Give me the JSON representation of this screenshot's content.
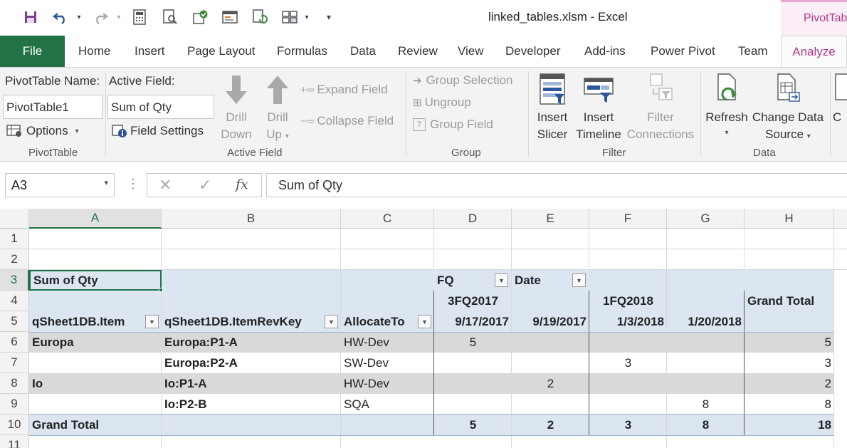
{
  "titlebar": {
    "title": "linked_tables.xlsm  -  Excel",
    "context_tab": "PivotTabl"
  },
  "tabs": [
    "Home",
    "Insert",
    "Page Layout",
    "Formulas",
    "Data",
    "Review",
    "View",
    "Developer",
    "Add-ins",
    "Power Pivot",
    "Team"
  ],
  "file_tab": "File",
  "active_tab": "Analyze",
  "ribbon": {
    "pivottable_name_label": "PivotTable Name:",
    "pivottable_name_value": "PivotTable1",
    "options_label": "Options",
    "pivottable_group": "PivotTable",
    "active_field_label": "Active Field:",
    "active_field_value": "Sum of Qty",
    "field_settings_label": "Field Settings",
    "drill_down": [
      "Drill",
      "Down"
    ],
    "drill_up": [
      "Drill",
      "Up"
    ],
    "expand_field": "Expand Field",
    "collapse_field": "Collapse Field",
    "active_field_group": "Active Field",
    "group_selection": "Group Selection",
    "ungroup": "Ungroup",
    "group_field": "Group Field",
    "group_group": "Group",
    "insert_slicer": [
      "Insert",
      "Slicer"
    ],
    "insert_timeline": [
      "Insert",
      "Timeline"
    ],
    "filter_connections": [
      "Filter",
      "Connections"
    ],
    "filter_group": "Filter",
    "refresh": "Refresh",
    "change_data_source": [
      "Change Data",
      "Source"
    ],
    "data_group": "Data",
    "cut_off": "C"
  },
  "formula_bar": {
    "name_box": "A3",
    "fx": "fx",
    "formula": "Sum of Qty"
  },
  "columns": [
    "A",
    "B",
    "C",
    "D",
    "E",
    "F",
    "G",
    "H"
  ],
  "rows": [
    "1",
    "2",
    "3",
    "4",
    "5",
    "6",
    "7",
    "8",
    "9",
    "10",
    "11"
  ],
  "pivot": {
    "a3": "Sum of Qty",
    "fq_label": "FQ",
    "date_label": "Date",
    "fq1": "3FQ2017",
    "fq2": "1FQ2018",
    "grand_total_header": "Grand Total",
    "item_header": "qSheet1DB.Item",
    "revkey_header": "qSheet1DB.ItemRevKey",
    "allocate_header": "AllocateTo",
    "dates": [
      "9/17/2017",
      "9/19/2017",
      "1/3/2018",
      "1/20/2018"
    ],
    "rows": [
      {
        "item": "Europa",
        "revkey": "Europa:P1-A",
        "alloc": "HW-Dev",
        "d": [
          "5",
          "",
          "",
          ""
        ],
        "total": "5"
      },
      {
        "item": "",
        "revkey": "Europa:P2-A",
        "alloc": "SW-Dev",
        "d": [
          "",
          "",
          "3",
          ""
        ],
        "total": "3"
      },
      {
        "item": "Io",
        "revkey": "Io:P1-A",
        "alloc": "HW-Dev",
        "d": [
          "",
          "2",
          "",
          ""
        ],
        "total": "2"
      },
      {
        "item": "",
        "revkey": "Io:P2-B",
        "alloc": "SQA",
        "d": [
          "",
          "",
          "",
          "8"
        ],
        "total": "8"
      }
    ],
    "grand_total_label": "Grand Total",
    "grand_totals": [
      "5",
      "2",
      "3",
      "8"
    ],
    "grand_total_all": "18"
  }
}
